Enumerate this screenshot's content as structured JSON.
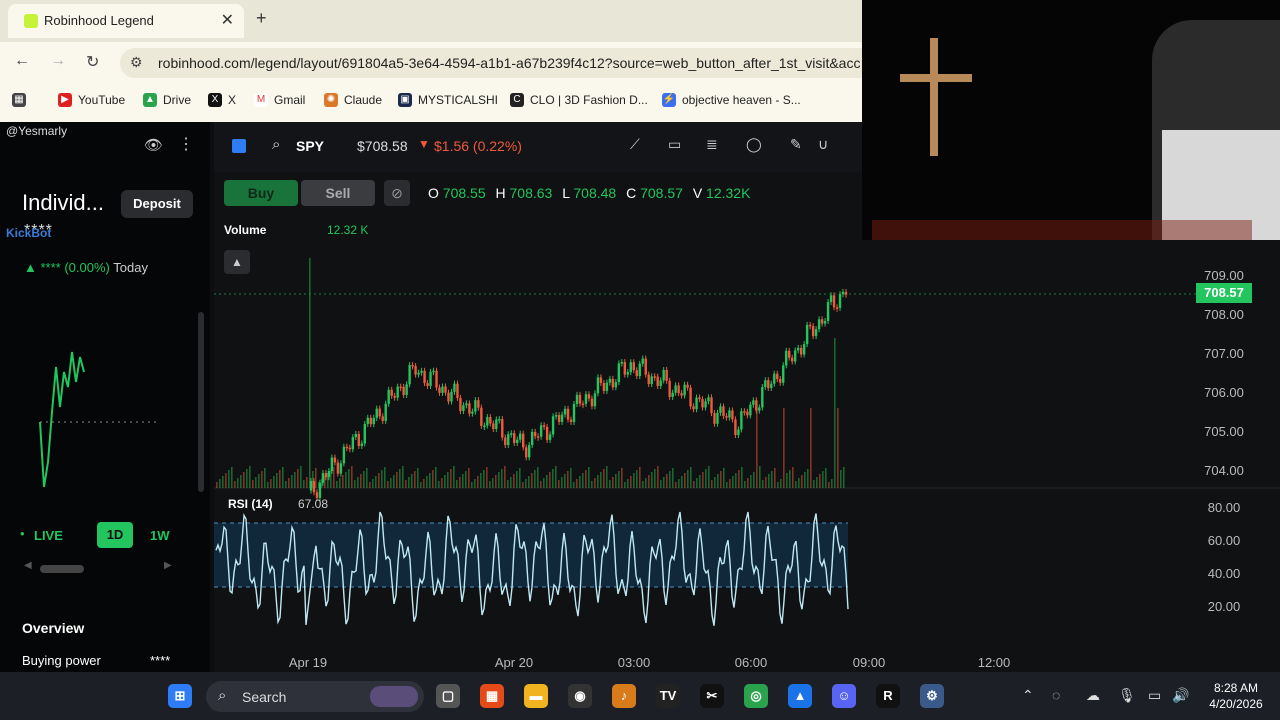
{
  "browser": {
    "tab_title": "Robinhood Legend",
    "url": "robinhood.com/legend/layout/691804a5-3e64-4594-a1b1-a67b239f4c12?source=web_button_after_1st_visit&acc",
    "bookmarks": [
      "YouTube",
      "Drive",
      "X",
      "Gmail",
      "Claude",
      "MYSTICALSHI",
      "CLO | 3D Fashion D...",
      "objective heaven - S..."
    ]
  },
  "left": {
    "username": "@Yesmarly",
    "kickbot": "KickBot",
    "account_name": "Individ...",
    "deposit_label": "Deposit",
    "account_mask": "****",
    "today_change": "**** (0.00%)",
    "today_label": "Today",
    "live_label": "LIVE",
    "range_1d": "1D",
    "range_1w": "1W",
    "overview": "Overview",
    "buying_power_label": "Buying power",
    "buying_power_value": "****"
  },
  "chart": {
    "symbol": "SPY",
    "price": "$708.58",
    "change": "$1.56 (0.22%)",
    "buy": "Buy",
    "sell": "Sell",
    "ohlc": {
      "o": "708.55",
      "h": "708.63",
      "l": "708.48",
      "c": "708.57",
      "v": "12.32K"
    },
    "volume_label": "Volume",
    "volume_value": "12.32 K",
    "rsi_label": "RSI (14)",
    "rsi_value": "67.08",
    "current_price_tag": "708.57",
    "price_ticks": [
      "709.00",
      "708.00",
      "707.00",
      "706.00",
      "705.00",
      "704.00"
    ],
    "rsi_ticks": [
      "80.00",
      "60.00",
      "40.00",
      "20.00"
    ],
    "time_ticks": [
      "Apr 19",
      "Apr 20",
      "03:00",
      "06:00",
      "09:00",
      "12:00"
    ]
  },
  "chart_data": {
    "type": "line",
    "title": "",
    "xlabel": "",
    "ylabel": "",
    "x": [
      "Apr 19",
      "Apr 20",
      "03:00",
      "06:00",
      "09:00"
    ],
    "series": [
      {
        "values": [
          704.0,
          706.8,
          705.1,
          706.9,
          705.6,
          708.6
        ]
      }
    ],
    "ylim": [
      704.0,
      709.0
    ],
    "rsi_ylim": [
      20,
      80
    ]
  },
  "taskbar": {
    "search": "Search",
    "time": "8:28 AM",
    "date": "4/20/2026"
  }
}
